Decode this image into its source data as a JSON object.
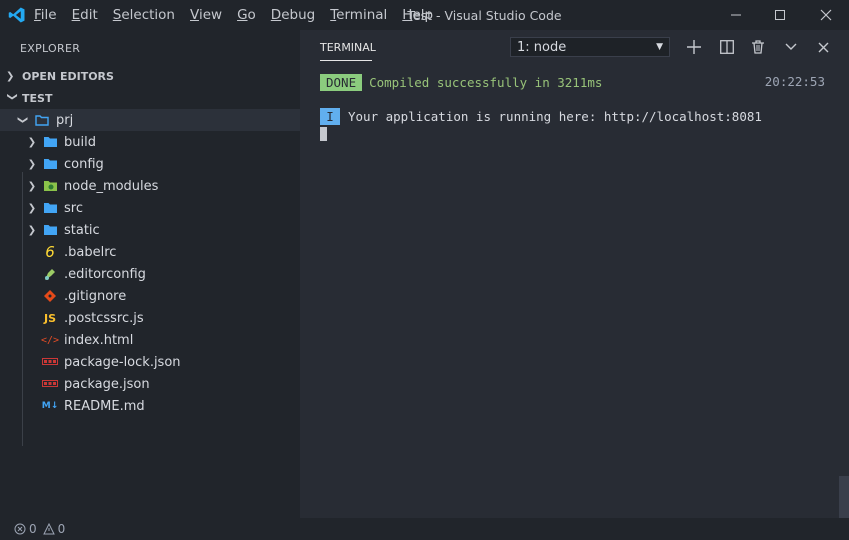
{
  "titlebar": {
    "menu": [
      {
        "first": "F",
        "rest": "ile"
      },
      {
        "first": "E",
        "rest": "dit"
      },
      {
        "first": "S",
        "rest": "election"
      },
      {
        "first": "V",
        "rest": "iew"
      },
      {
        "first": "G",
        "rest": "o"
      },
      {
        "first": "D",
        "rest": "ebug"
      },
      {
        "first": "T",
        "rest": "erminal"
      },
      {
        "first": "H",
        "rest": "elp"
      }
    ],
    "window_title": "Test - Visual Studio Code",
    "controls": [
      "minimize-icon",
      "maximize-icon",
      "close-icon"
    ]
  },
  "sidebar": {
    "title": "EXPLORER",
    "open_editors": "OPEN EDITORS",
    "workspace": "TEST",
    "root_folder": "prj",
    "folders": [
      "build",
      "config",
      "node_modules",
      "src",
      "static"
    ],
    "files": [
      ".babelrc",
      ".editorconfig",
      ".gitignore",
      ".postcssrc.js",
      "index.html",
      "package-lock.json",
      "package.json",
      "README.md"
    ]
  },
  "panel": {
    "tab": "TERMINAL",
    "terminal_select": "1: node",
    "actions": [
      "plus-icon",
      "split-icon",
      "trash-icon",
      "chevron-down-icon",
      "close-icon"
    ],
    "lines": {
      "done_badge": "DONE",
      "compiled": "Compiled successfully in 3211ms",
      "timestamp": "20:22:53",
      "info_badge": "I",
      "running": "Your application is running here: http://localhost:8081"
    }
  },
  "statusbar": {
    "errors": "0",
    "warnings": "0"
  },
  "colors": {
    "done_badge": "#8bcc7e",
    "compiled_text": "#98c379",
    "info_badge": "#61afef",
    "folder_icon": "#42a5f5",
    "panel_bg": "#282c34",
    "sidebar_bg": "#21252b"
  }
}
